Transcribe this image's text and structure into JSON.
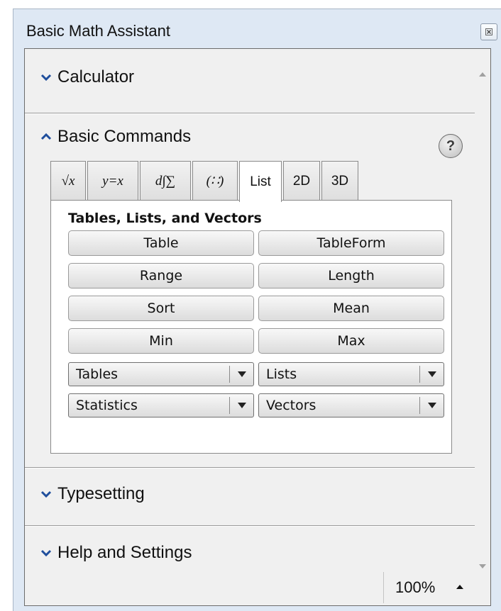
{
  "window": {
    "title": "Basic Math Assistant",
    "close_icon": "close-icon"
  },
  "sections": {
    "calculator": "Calculator",
    "basic_commands": "Basic Commands",
    "typesetting": "Typesetting",
    "help_settings": "Help and Settings"
  },
  "help_button": "?",
  "tabs": [
    {
      "label": "√x"
    },
    {
      "label": "y=x"
    },
    {
      "label": "d∫∑"
    },
    {
      "label": "(∷)"
    },
    {
      "label": "List",
      "active": true
    },
    {
      "label": "2D"
    },
    {
      "label": "3D"
    }
  ],
  "panel": {
    "title": "Tables, Lists, and Vectors",
    "buttons": [
      "Table",
      "TableForm",
      "Range",
      "Length",
      "Sort",
      "Mean",
      "Min",
      "Max"
    ],
    "dropdowns": [
      "Tables",
      "Lists",
      "Statistics",
      "Vectors"
    ]
  },
  "zoom": "100%",
  "colors": {
    "chevron": "#1f4e9c",
    "window_frame": "#dee8f4"
  }
}
